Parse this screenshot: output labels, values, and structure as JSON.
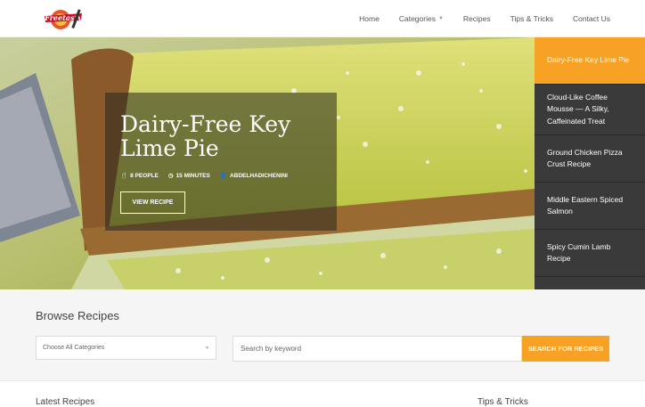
{
  "brand": {
    "logo_text": "Freetasty"
  },
  "nav": {
    "items": [
      {
        "label": "Home"
      },
      {
        "label": "Categories"
      },
      {
        "label": "Recipes"
      },
      {
        "label": "Tips & Tricks"
      },
      {
        "label": "Contact Us"
      }
    ]
  },
  "hero": {
    "title": "Dairy-Free Key Lime Pie",
    "people": "8 PEOPLE",
    "time": "15 MINUTES",
    "author": "ABDELHADICHENINI",
    "button": "VIEW RECIPE"
  },
  "slider": {
    "items": [
      {
        "label": "Dairy-Free Key Lime Pie",
        "active": true
      },
      {
        "label": "Cloud-Like Coffee Mousse — A Silky, Caffeinated Treat"
      },
      {
        "label": "Ground Chicken Pizza Crust Recipe"
      },
      {
        "label": "Middle Eastern Spiced Salmon"
      },
      {
        "label": "Spicy Cumin Lamb Recipe"
      }
    ]
  },
  "browse": {
    "title": "Browse Recipes",
    "category_value": "Choose All Categories",
    "search_placeholder": "Search by keyword",
    "search_button": "SEARCH FOR RECIPES"
  },
  "lower": {
    "left_heading": "Latest Recipes",
    "right_heading": "Tips & Tricks"
  },
  "colors": {
    "accent": "#f7a224",
    "sidebar": "#3a3a3a"
  }
}
